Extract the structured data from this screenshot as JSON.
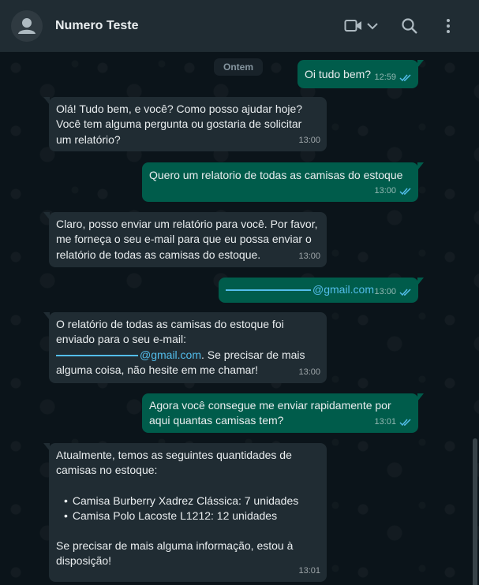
{
  "header": {
    "contact_name": "Numero Teste",
    "icons": [
      "person-avatar-icon",
      "video-call-icon",
      "chevron-down-icon",
      "search-icon",
      "menu-dots-icon"
    ]
  },
  "chat": {
    "date_chip": "Ontem",
    "messages": [
      {
        "dir": "out",
        "text": "Oi tudo bem?",
        "time": "12:59",
        "status": "read"
      },
      {
        "dir": "in",
        "lines": [
          "Olá! Tudo bem, e você? Como posso ajudar hoje?",
          "Você tem alguma pergunta ou gostaria de solicitar",
          "um relatório?"
        ],
        "time": "13:00"
      },
      {
        "dir": "out",
        "text": "Quero um relatorio de todas as camisas do estoque",
        "time": "13:00",
        "status": "read"
      },
      {
        "dir": "in",
        "lines": [
          "Claro, posso enviar um relatório para você. Por favor,",
          "me forneça o seu e-mail para que eu possa enviar o",
          "relatório de todas as camisas do estoque."
        ],
        "time": "13:00"
      },
      {
        "dir": "out",
        "email_domain": "@gmail.com",
        "time": "13:00",
        "status": "read"
      },
      {
        "dir": "in",
        "lines": [
          "O relatório de todas as camisas do estoque foi",
          "enviado para o seu e-mail:"
        ],
        "email_domain": "@gmail.com",
        "after_email": ". Se precisar de mais",
        "last_line": "alguma coisa, não hesite em me chamar!",
        "time": "13:00"
      },
      {
        "dir": "out",
        "lines": [
          "Agora você consegue me enviar rapidamente por",
          "aqui quantas camisas tem?"
        ],
        "time": "13:01",
        "status": "read"
      },
      {
        "dir": "in",
        "intro": [
          "Atualmente, temos as seguintes quantidades de",
          "camisas no estoque:"
        ],
        "items": [
          "Camisa Burberry Xadrez Clássica: 7 unidades",
          "Camisa Polo Lacoste L1212: 12 unidades"
        ],
        "outro": [
          "Se precisar de mais alguma informação, estou à",
          "disposição!"
        ],
        "time": "13:01"
      }
    ]
  },
  "colors": {
    "header_bg": "#202c33",
    "chat_bg": "#0b141a",
    "incoming_bubble": "#202c33",
    "outgoing_bubble": "#005c4b",
    "link": "#53bdeb",
    "read_tick": "#53bdeb"
  }
}
